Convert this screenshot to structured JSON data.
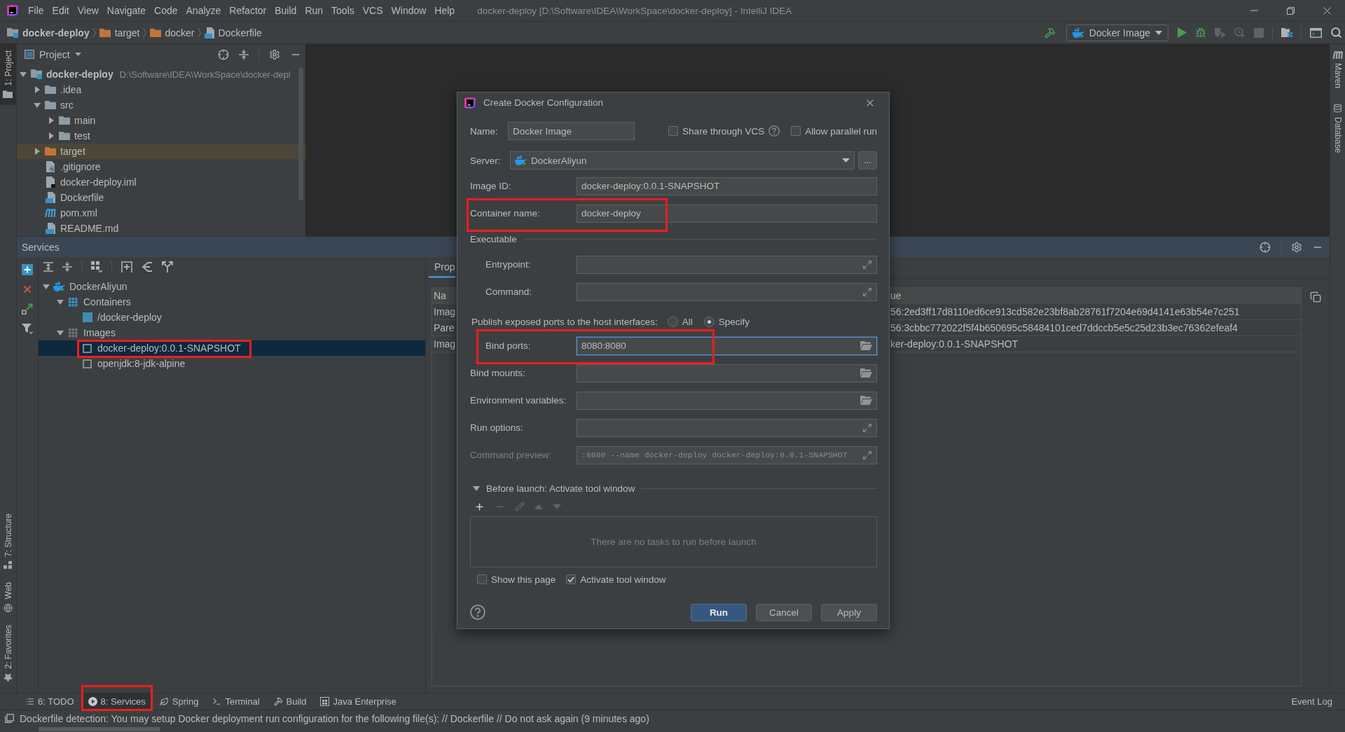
{
  "window": {
    "title": "docker-deploy [D:\\Software\\IDEA\\WorkSpace\\docker-deploy] - IntelliJ IDEA"
  },
  "menu_bar": [
    "File",
    "Edit",
    "View",
    "Navigate",
    "Code",
    "Analyze",
    "Refactor",
    "Build",
    "Run",
    "Tools",
    "VCS",
    "Window",
    "Help"
  ],
  "navigation_bar": {
    "breadcrumbs": [
      {
        "label": "docker-deploy",
        "kind": "module"
      },
      {
        "label": "target",
        "kind": "excluded"
      },
      {
        "label": "docker",
        "kind": "excluded"
      },
      {
        "label": "Dockerfile",
        "kind": "dockerfile"
      }
    ],
    "run_configuration": "Docker Image",
    "actions": [
      {
        "kind": "run",
        "disabled": false
      },
      {
        "kind": "debug",
        "disabled": false
      },
      {
        "kind": "coverage",
        "disabled": true
      },
      {
        "kind": "profile",
        "disabled": true
      },
      {
        "kind": "stop",
        "disabled": true
      }
    ]
  },
  "left_stripe": {
    "top": [
      {
        "label": "1: Project",
        "kind": "project",
        "selected": true
      }
    ],
    "bottom": [
      {
        "label": "7: Structure",
        "kind": "structure",
        "selected": false
      },
      {
        "label": "Web",
        "kind": "web",
        "selected": false
      },
      {
        "label": "2: Favorites",
        "kind": "favorites",
        "selected": false
      }
    ]
  },
  "right_stripe": [
    {
      "label": "Maven",
      "kind": "maven"
    },
    {
      "label": "Database",
      "kind": "database"
    }
  ],
  "project": {
    "title": "Project",
    "tree": [
      {
        "label": "docker-deploy",
        "path": "D:\\Software\\IDEA\\WorkSpace\\docker-depl",
        "kind": "module",
        "expanded": true,
        "children": [
          {
            "label": ".idea",
            "kind": "folder",
            "expanded": false
          },
          {
            "label": "src",
            "kind": "folder",
            "expanded": true,
            "children": [
              {
                "label": "main",
                "kind": "folder",
                "expanded": false
              },
              {
                "label": "test",
                "kind": "folder",
                "expanded": false
              }
            ]
          },
          {
            "label": "target",
            "kind": "excluded",
            "expanded": false
          },
          {
            "label": ".gitignore",
            "kind": "gitignore"
          },
          {
            "label": "docker-deploy.iml",
            "kind": "iml"
          },
          {
            "label": "Dockerfile",
            "kind": "dockerfile"
          },
          {
            "label": "pom.xml",
            "kind": "maven"
          },
          {
            "label": "README.md",
            "kind": "markdown"
          }
        ]
      }
    ]
  },
  "services": {
    "title": "Services",
    "tree": [
      {
        "label": "DockerAliyun",
        "kind": "server",
        "expanded": true,
        "selected": false,
        "highlighted": false,
        "children": [
          {
            "label": "Containers",
            "kind": "containers",
            "expanded": true,
            "selected": false,
            "highlighted": false,
            "children": [
              {
                "label": "/docker-deploy",
                "kind": "container",
                "selected": false,
                "highlighted": false
              }
            ]
          },
          {
            "label": "Images",
            "kind": "images",
            "expanded": true,
            "selected": false,
            "highlighted": false,
            "children": [
              {
                "label": "docker-deploy:0.0.1-SNAPSHOT",
                "kind": "image",
                "selected": true,
                "highlighted": true
              },
              {
                "label": "openjdk:8-jdk-alpine",
                "kind": "image",
                "selected": false,
                "highlighted": false
              }
            ]
          }
        ]
      }
    ],
    "properties": {
      "tabs": [
        {
          "label": "Prop",
          "selected": true
        }
      ],
      "columns": [
        "Na",
        "ue"
      ],
      "rows": [
        [
          "Imag",
          "56:2ed3ff17d8110ed6ce913cd582e23bf8ab28761f7204e69d4141e63b54e7c251"
        ],
        [
          "Pare",
          "56:3cbbc772022f5f4b650695c58484101ced7ddccb5e5c25d23b3ec76362efeaf4"
        ],
        [
          "Imag",
          "ker-deploy:0.0.1-SNAPSHOT"
        ]
      ]
    }
  },
  "tool_window_bar": {
    "tabs": [
      {
        "label": "6: TODO",
        "kind": "todo",
        "selected": false,
        "highlighted": false
      },
      {
        "label": "8: Services",
        "kind": "services",
        "selected": true,
        "highlighted": true
      },
      {
        "label": "Spring",
        "kind": "spring",
        "selected": false,
        "highlighted": false
      },
      {
        "label": "Terminal",
        "kind": "terminal",
        "selected": false,
        "highlighted": false
      },
      {
        "label": "Build",
        "kind": "build",
        "selected": false,
        "highlighted": false
      },
      {
        "label": "Java Enterprise",
        "kind": "javaee",
        "selected": false,
        "highlighted": false
      }
    ],
    "right": [
      {
        "label": "Event Log",
        "selected": false
      }
    ]
  },
  "status_bar": {
    "message": "Dockerfile detection: You may setup Docker deployment run configuration for the following file(s): // Dockerfile // Do not ask again (9 minutes ago)"
  },
  "dialog": {
    "title": "Create Docker Configuration",
    "name": {
      "label": "Name:",
      "value": "Docker Image"
    },
    "options": [
      {
        "label": "Share through VCS",
        "checked": false,
        "help": true
      },
      {
        "label": "Allow parallel run",
        "checked": false,
        "help": false
      }
    ],
    "server": {
      "label": "Server:",
      "value": "DockerAliyun",
      "more": "..."
    },
    "rows": [
      {
        "kind": "text",
        "label": "Image ID:",
        "value": "docker-deploy:0.0.1-SNAPSHOT",
        "focused": false,
        "highlighted": false
      },
      {
        "kind": "text",
        "label": "Container name:",
        "value": "docker-deploy",
        "focused": false,
        "highlighted": true
      },
      {
        "kind": "section",
        "label": "Executable",
        "highlighted": false,
        "children": [
          {
            "kind": "expand",
            "label": "Entrypoint:",
            "focused": false,
            "highlighted": false
          },
          {
            "kind": "expand",
            "label": "Command:",
            "focused": false,
            "highlighted": false
          }
        ]
      },
      {
        "kind": "radio",
        "label": "Publish exposed ports to the host interfaces:",
        "highlighted": false,
        "options": [
          {
            "label": "All",
            "selected": false
          },
          {
            "label": "Specify",
            "selected": true
          }
        ],
        "children": [
          {
            "kind": "browse",
            "label": "Bind ports:",
            "value": "8080:8080",
            "focused": true,
            "highlighted": true
          }
        ]
      },
      {
        "kind": "browse",
        "label": "Bind mounts:",
        "focused": false,
        "highlighted": false
      },
      {
        "kind": "browse",
        "label": "Environment variables:",
        "focused": false,
        "highlighted": false
      },
      {
        "kind": "expand",
        "label": "Run options:",
        "focused": false,
        "highlighted": false
      },
      {
        "kind": "preview",
        "label": "Command preview:",
        "value": ":8080 --name docker-deploy docker-deploy:0.0.1-SNAPSHOT",
        "focused": false,
        "highlighted": false
      }
    ],
    "before_launch": {
      "title": "Before launch: Activate tool window",
      "expanded": true,
      "tools": [
        {
          "kind": "add",
          "disabled": false
        },
        {
          "kind": "remove",
          "disabled": true
        },
        {
          "kind": "edit",
          "disabled": true
        },
        {
          "kind": "up",
          "disabled": true
        },
        {
          "kind": "down",
          "disabled": true
        }
      ],
      "empty_text": "There are no tasks to run before launch"
    },
    "checkboxes": [
      {
        "label": "Show this page",
        "checked": false
      },
      {
        "label": "Activate tool window",
        "checked": true
      }
    ],
    "buttons": [
      {
        "label": "Run",
        "default": true
      },
      {
        "label": "Cancel",
        "default": false
      },
      {
        "label": "Apply",
        "default": false
      }
    ]
  }
}
